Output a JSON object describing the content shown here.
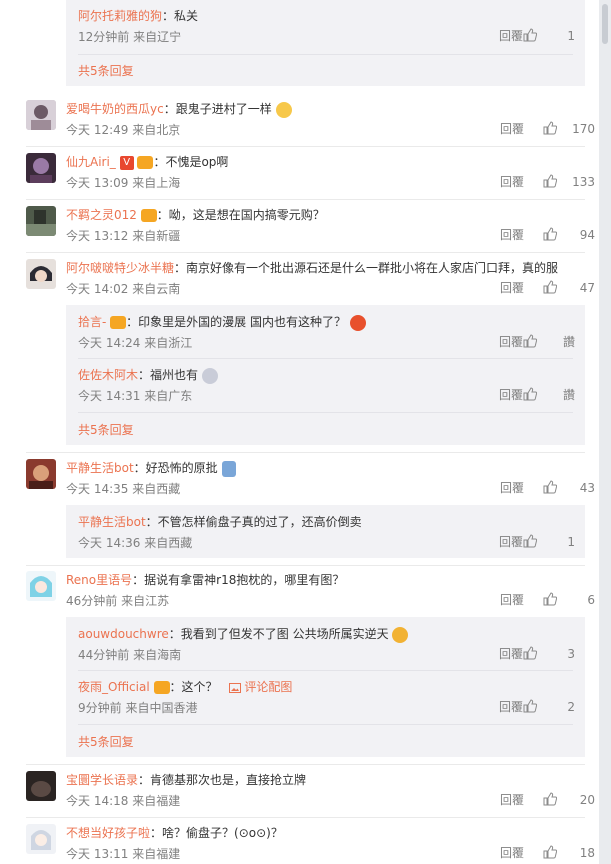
{
  "comments_top": {
    "reply": {
      "user": "阿尔托莉雅的狗",
      "text": "：私关",
      "time": "12分钟前 来自辽宁",
      "reply_label": "回覆",
      "likes": "1"
    },
    "more": "共5条回复"
  },
  "comments": [
    {
      "user": "爱喝牛奶的西瓜yc",
      "text": "：跟鬼子进村了一样",
      "time": "今天 12:49 来自北京",
      "reply_label": "回覆",
      "likes": "170"
    },
    {
      "user": "仙九Airi_",
      "text": "：不愧是op啊",
      "time": "今天 13:09 来自上海",
      "reply_label": "回覆",
      "likes": "133"
    },
    {
      "user": "不羁之灵012",
      "text": "：呦，这是想在国内搞零元购？",
      "time": "今天 13:12 来自新疆",
      "reply_label": "回覆",
      "likes": "94"
    },
    {
      "user": "阿尔啵啵特少冰半糖",
      "text": "：南京好像有一个批出源石还是什么一群批小将在人家店门口拜，真的服",
      "time": "今天 14:02 来自云南",
      "reply_label": "回覆",
      "likes": "47",
      "replies": [
        {
          "user": "拾言-",
          "text": "：印象里是外国的漫展 国内也有这种了？",
          "time": "今天 14:24 来自浙江",
          "reply_label": "回覆",
          "likes": "讚"
        },
        {
          "user": "佐佐木阿木",
          "text": "：福州也有",
          "time": "今天 14:31 来自广东",
          "reply_label": "回覆",
          "likes": "讚"
        }
      ],
      "more": "共5条回复"
    },
    {
      "user": "平静生活bot",
      "text": "：好恐怖的原批",
      "time": "今天 14:35 来自西藏",
      "reply_label": "回覆",
      "likes": "43",
      "replies": [
        {
          "user": "平静生活bot",
          "text": "：不管怎样偷盘子真的过了，还高价倒卖",
          "time": "今天 14:36 来自西藏",
          "reply_label": "回覆",
          "likes": "1"
        }
      ]
    },
    {
      "user": "Reno里语号",
      "text": "：据说有拿雷神r18抱枕的，哪里有图？",
      "time": "46分钟前 来自江苏",
      "reply_label": "回覆",
      "likes": "6",
      "replies": [
        {
          "user": "aouwdouchwre",
          "text": "：我看到了但发不了图 公共场所属实逆天",
          "time": "44分钟前 来自海南",
          "reply_label": "回覆",
          "likes": "3"
        },
        {
          "user": "夜雨_Official",
          "text": "：这个？",
          "pic_note": "评论配图",
          "time": "9分钟前 来自中国香港",
          "reply_label": "回覆",
          "likes": "2"
        }
      ],
      "more": "共5条回复"
    },
    {
      "user": "宝圜学长语录",
      "text": "：肯德基那次也是，直接抢立牌",
      "time": "今天 14:18 来自福建",
      "reply_label": "回覆",
      "likes": "20"
    },
    {
      "user": "不想当好孩子啦",
      "text": "：啥？偷盘子？(⊙o⊙)？",
      "time": "今天 13:11 来自福建",
      "reply_label": "回覆",
      "likes": "18"
    }
  ]
}
